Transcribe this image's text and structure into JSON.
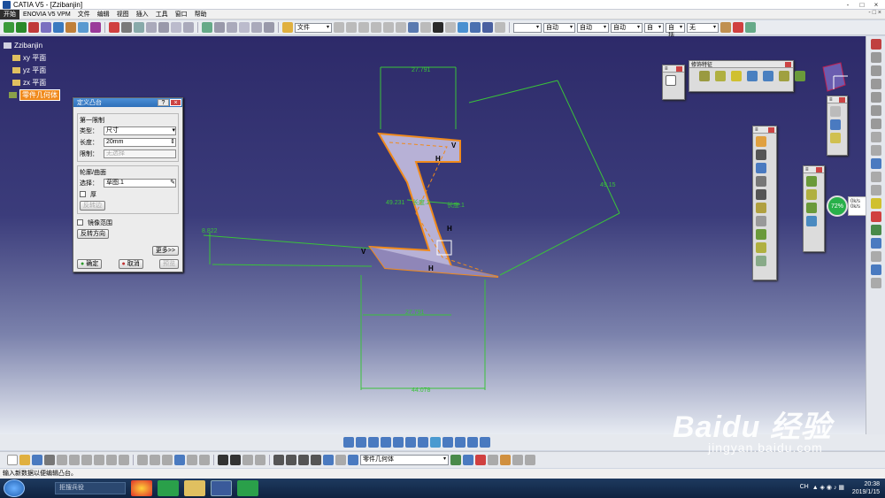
{
  "window": {
    "title": "CATIA V5 - [Zzibanjin]",
    "controls": [
      "-",
      "□",
      "×"
    ]
  },
  "menu": {
    "items": [
      "开始",
      "ENOVIA V5 VPM",
      "文件",
      "编辑",
      "视图",
      "插入",
      "工具",
      "窗口",
      "帮助"
    ],
    "right_controls": [
      "-",
      "□",
      "×"
    ]
  },
  "toolbar": {
    "combo_style": "文件",
    "combo_line": "",
    "combo_auto1": "自动",
    "combo_auto2": "自动",
    "combo_auto3": "自动",
    "combo_auto4": "自",
    "combo_layer": "自括",
    "combo_none": "无"
  },
  "tree": {
    "root": "Zzibanjin",
    "items": [
      "xy 平面",
      "yz 平面",
      "zx 平面"
    ],
    "selected": "零件几何体"
  },
  "dialog": {
    "title": "定义凸台",
    "help": "?",
    "close": "×",
    "group1": "第一限制",
    "type_label": "类型：",
    "type_value": "尺寸",
    "length_label": "长度：",
    "length_value": "20mm",
    "limit_label": "限制：",
    "limit_value": "无选择",
    "group2": "轮廓/曲面",
    "select_label": "选择：",
    "select_value": "草图.1",
    "thick_label": "厚",
    "disabled_btn": "反转边",
    "mirror_label": "镜像范围",
    "reverse_btn": "反转方向",
    "more_btn": "更多>>",
    "ok_btn": "确定",
    "cancel_btn": "取消",
    "preview_btn": "预览"
  },
  "panels": {
    "feature_title": "修饰特征"
  },
  "dimensions": {
    "d1": "27.791",
    "d2": "49.15",
    "d3": "49.231",
    "d4": "8.822",
    "d5": "27.791",
    "d6": "44.078"
  },
  "labels": {
    "h1": "H",
    "v1": "V",
    "h2": "H",
    "v2": "V",
    "h3": "H",
    "mid1": "长度.2",
    "mid2": "长度.1"
  },
  "bottom": {
    "combo_body": "零件几何体"
  },
  "gauge": {
    "percent": "72%",
    "line1": "0k/s",
    "line2": "0k/s"
  },
  "status": {
    "text": "输入新数据以便编辑凸台。"
  },
  "taskbar": {
    "search": "拒搜兵役",
    "time": "20:38",
    "date": "2019/1/15",
    "lang": "CH"
  },
  "watermark": {
    "brand": "Baidu 经验",
    "url": "jingyan.baidu.com"
  },
  "colors": {
    "sketch": "#33c23a",
    "part": "#b7b1d6",
    "edge": "#f08a1c",
    "bg_top": "#2d2a69"
  }
}
